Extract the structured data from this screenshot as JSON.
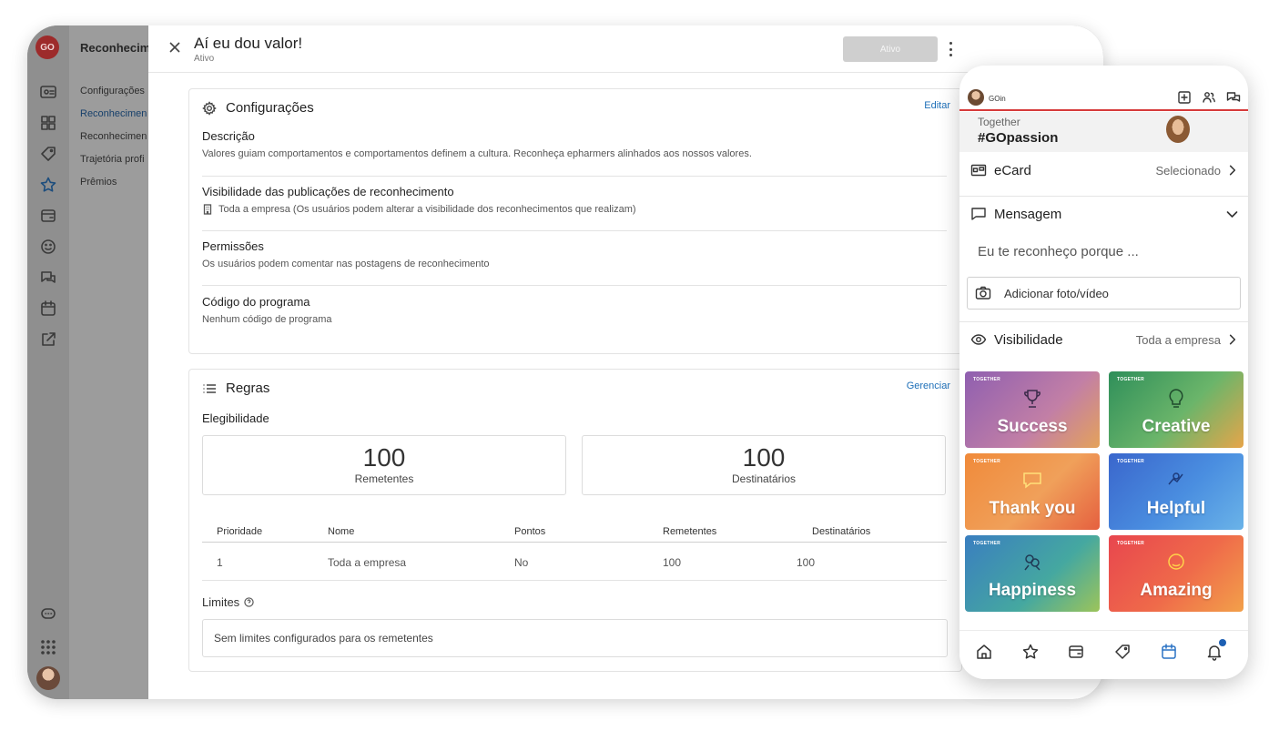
{
  "app": {
    "logo_text": "GO",
    "section_title": "Reconhecim"
  },
  "subnav": {
    "items": [
      {
        "label": "Configurações"
      },
      {
        "label": "Reconhecimen"
      },
      {
        "label": "Reconhecimen"
      },
      {
        "label": "Trajetória profi"
      },
      {
        "label": "Prêmios"
      }
    ]
  },
  "rail_icons": [
    "id-card-icon",
    "grid-icon",
    "tag-icon",
    "star-icon",
    "wallet-icon",
    "smiley-icon",
    "chat-icon",
    "calendar-icon",
    "external-link-icon",
    "chat-bubble-icon",
    "apps-grid-icon"
  ],
  "header": {
    "title": "Aí eu dou valor!",
    "status": "Ativo",
    "button_label": "Ativo"
  },
  "config": {
    "title": "Configurações",
    "edit_label": "Editar",
    "descricao_label": "Descrição",
    "descricao_value": "Valores guiam comportamentos e comportamentos definem a cultura. Reconheça epharmers alinhados aos nossos valores.",
    "visibilidade_label": "Visibilidade das publicações de reconhecimento",
    "visibilidade_value": "Toda a empresa (Os usuários podem alterar a visibilidade dos reconhecimentos que realizam)",
    "permissoes_label": "Permissões",
    "permissoes_value": "Os usuários podem comentar nas postagens de reconhecimento",
    "codigo_label": "Código do programa",
    "codigo_value": "Nenhum código de programa"
  },
  "rules": {
    "title": "Regras",
    "manage_label": "Gerenciar",
    "eligibility_label": "Elegibilidade",
    "senders_count": "100",
    "senders_label": "Remetentes",
    "recipients_count": "100",
    "recipients_label": "Destinatários",
    "table": {
      "headers": [
        "Prioridade",
        "Nome",
        "Pontos",
        "Remetentes",
        "Destinatários"
      ],
      "rows": [
        [
          "1",
          "Toda a empresa",
          "No",
          "100",
          "100"
        ]
      ]
    },
    "limits_label": "Limites",
    "limits_value": "Sem limites configurados para os remetentes"
  },
  "phone": {
    "brand": "GOin",
    "banner_small": "Together",
    "banner_big": "#GOpassion",
    "ecard_label": "eCard",
    "ecard_value": "Selecionado",
    "message_label": "Mensagem",
    "message_placeholder": "Eu te reconheço porque ...",
    "photo_label": "Adicionar foto/vídeo",
    "visibility_label": "Visibilidade",
    "visibility_value": "Toda a empresa",
    "tiles": [
      {
        "tag": "TOGETHER",
        "name": "Success",
        "color": "#9a6fb0"
      },
      {
        "tag": "TOGETHER",
        "name": "Creative",
        "color": "#3f9e6a"
      },
      {
        "tag": "TOGETHER",
        "name": "Thank you",
        "color": "#ef7a3a"
      },
      {
        "tag": "TOGETHER",
        "name": "Helpful",
        "color": "#3c6fd0"
      },
      {
        "tag": "TOGETHER",
        "name": "Happiness",
        "color": "#3a88c4"
      },
      {
        "tag": "TOGETHER",
        "name": "Amazing",
        "color": "#e54a52"
      }
    ],
    "nav_icons": [
      "home-icon",
      "star-icon",
      "wallet-icon",
      "tag-icon",
      "calendar-icon",
      "bell-icon"
    ]
  },
  "colors": {
    "accent": "#1d6fb8",
    "brand_red": "#d63a3a",
    "overlay": "#9c9c9c"
  }
}
